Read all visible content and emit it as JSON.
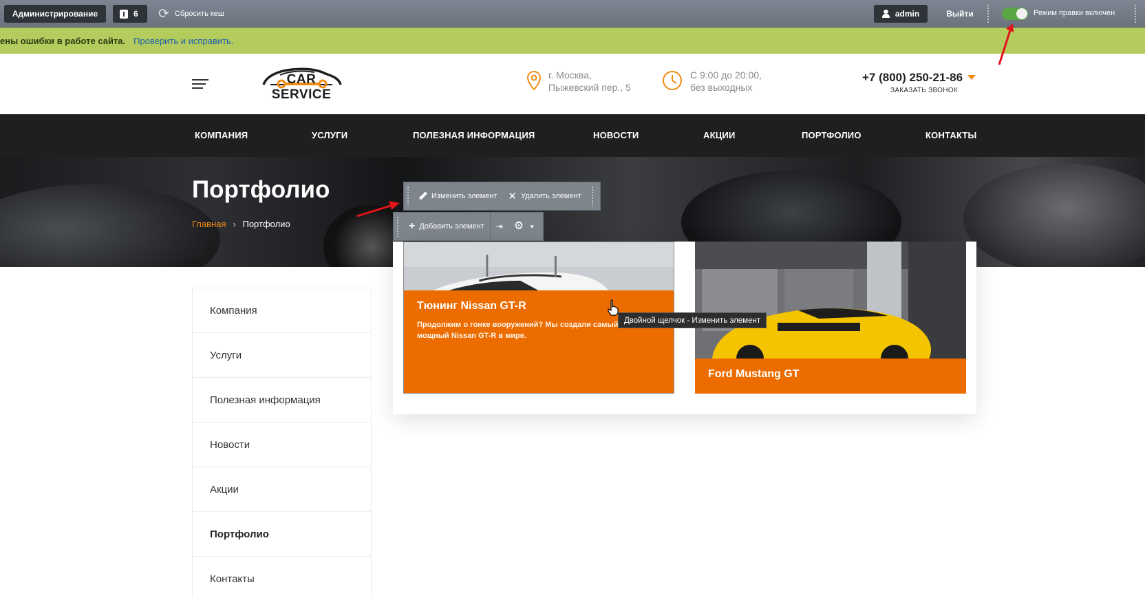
{
  "admin_bar": {
    "admin_label": "Администрирование",
    "notifications_count": "6",
    "reset_cache_label": "Сбросить кеш",
    "user_label": "admin",
    "logout_label": "Выйти",
    "edit_mode_label": "Режим правки включен",
    "edit_mode_on": true
  },
  "warning_bar": {
    "text": "ены ошибки в работе сайта.",
    "link": "Проверить и исправить."
  },
  "header": {
    "logo_text": "CAR SERVICE",
    "address_line1": "г. Москва,",
    "address_line2": "Пыжевский пер., 5",
    "hours_line1": "С 9:00 до 20:00,",
    "hours_line2": "без выходных",
    "phone": "+7 (800) 250-21-86",
    "callback_label": "ЗАКАЗАТЬ ЗВОНОК"
  },
  "nav": {
    "items": [
      "КОМПАНИЯ",
      "УСЛУГИ",
      "ПОЛЕЗНАЯ ИНФОРМАЦИЯ",
      "НОВОСТИ",
      "АКЦИИ",
      "ПОРТФОЛИО",
      "КОНТАКТЫ"
    ]
  },
  "banner": {
    "title": "Портфолио",
    "breadcrumb_home": "Главная",
    "breadcrumb_current": "Портфолио"
  },
  "edit_toolbar": {
    "edit_label": "Изменить элемент",
    "delete_label": "Удалить элемент",
    "add_label": "Добавить элемент"
  },
  "sidebar": {
    "items": [
      "Компания",
      "Услуги",
      "Полезная информация",
      "Новости",
      "Акции",
      "Портфолио",
      "Контакты"
    ],
    "active": "Портфолио"
  },
  "portfolio": {
    "cards": [
      {
        "title": "Тюнинг Nissan GT-R",
        "description": "Продолжим о гонке вооружений? Мы создали самый мощный Nissan GT-R в мире."
      },
      {
        "title": "Ford Mustang GT",
        "description": ""
      }
    ]
  },
  "tooltip": {
    "text": "Двойной щелчок - Изменить элемент"
  },
  "colors": {
    "accent": "#ED6C00",
    "nav_bg": "#1F1F1F",
    "admin_bar": "#737B86",
    "warning_bar": "#B4CC5E",
    "toggle_on": "#5BA545"
  }
}
